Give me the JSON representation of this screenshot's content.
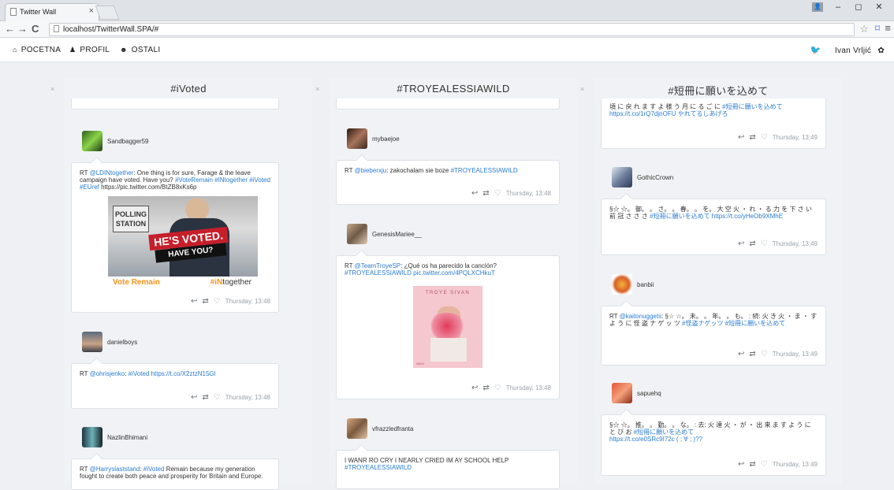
{
  "browser": {
    "tab_title": "Twitter Wall",
    "tab_close": "×",
    "url": "localhost/TwitterWall.SPA/#",
    "window_controls": [
      "–",
      "◻",
      "✕"
    ]
  },
  "nav": {
    "home": "POCETNA",
    "profile": "PROFIL",
    "other": "OSTALI",
    "user_name": "Ivan Vrljić"
  },
  "columns": [
    {
      "title": "#iVoted",
      "close": "×",
      "tweets": [
        {
          "user": "Sandbagger59",
          "pre": "RT ",
          "mention": "@LDINtogether",
          "body": ": One thing is for sure, Farage & the leave campaign have voted. Have you? ",
          "tags": "#VoteRemain #INtogether #iVoted #EUref",
          "link": " https://pic.twitter.com/BtZB8xKs6p",
          "time": "Thursday, 13:48",
          "image": {
            "sign1": "POLLING",
            "sign2": "STATION",
            "line1": "HE'S VOTED.",
            "line2": "HAVE YOU?",
            "foot_left": "Vote Remain",
            "foot_right_tag": "#iN",
            "foot_right": "together"
          }
        },
        {
          "user": "danielboys",
          "pre": "RT ",
          "mention": "@ohrisjenko",
          "body": ": ",
          "tags": "#iVoted",
          "link": " https://t.co/X2ztzN15Gl",
          "time": "Thursday, 13:48"
        },
        {
          "user": "NazlinBhimani",
          "pre": "RT ",
          "mention": "@Harryslaststand",
          "body": ": ",
          "tags": "#iVoted",
          "link": " Remain because my generation fought to create both peace and prosperity for Britain and Europe.",
          "time": ""
        }
      ]
    },
    {
      "title": "#TROYEALESSIAWILD",
      "close": "×",
      "tweets": [
        {
          "user": "mybaejoe",
          "pre": "RT ",
          "mention": "@bieberxju",
          "body": ": zakochalam sie boze ",
          "tags": "#TROYEALESSIAWILD",
          "link": "",
          "time": "Thursday, 13:48"
        },
        {
          "user": "GenesisMariee__",
          "pre": "RT ",
          "mention": "@TeamTroyeSP",
          "body": ": ¿Qué os ha parecido la canción? ",
          "tags": "#TROYEALESSIAWILD",
          "link": " pic.twitter.com/4PQLXCHkuT",
          "time": "Thursday, 13:48",
          "image": {
            "title": "TROYE SIVAN",
            "foot": "WILD"
          }
        },
        {
          "user": "vfrazzledfranta",
          "pre": "",
          "mention": "",
          "body": "I WANR RO CRY I NEARLY CRIED IM AY SCHOOL HELP ",
          "tags": "#TROYEALESSIAWILD",
          "link": "",
          "time": ""
        }
      ]
    },
    {
      "title": "#短冊に願いを込めて",
      "close": "×",
      "tweets": [
        {
          "user": "",
          "pre": "",
          "mention": "",
          "body": "頃 に 戻 れ ま す よ 様 う 月 に る ご に ",
          "tags": "#短冊に願いを込めて",
          "link": " https://t.co/1rQ7djnOFU やれてるしあげろ",
          "time": "Thursday, 13:49"
        },
        {
          "user": "GothicCrown",
          "pre": "",
          "mention": "",
          "body": "§☆ ☆。 御。 。 さ。 。 春。 。 を。 大 空 火 ・ れ ・ る 力 を 下 さ い 前 冠 さ さ さ ",
          "tags": "#短冊に願いを込めて",
          "link": " https://t.co/yHeOb9XMhE",
          "time": "Thursday, 13:49"
        },
        {
          "user": "banbii",
          "pre": "RT ",
          "mention": "@kaitonuggets",
          "body": ": §☆ ☆。 未。 。 年。 。 も。 : 続: 火 き 火 ・ ま ・ す よ う に 怪 盗 ナ ゲ ッ ツ ",
          "tags": "#怪盗ナゲッツ #短冊に願いを込めて",
          "link": "",
          "time": "Thursday, 13:49"
        },
        {
          "user": "sapuehq",
          "pre": "",
          "mention": "",
          "body": "§☆ ☆。 推。 。 勤。 。 な。 : 去: 火 達 火 ・ が ・ 出 来 ま す よ う に と び お ",
          "tags": "#短冊に願いを込めて",
          "link": " https://t.co/e0SRc9I72c ( ; ∀ ; )??",
          "time": "Thursday, 13:49"
        }
      ]
    }
  ],
  "colors": {
    "link": "#2b7bd0",
    "background": "#eef0f3",
    "card": "#ffffff"
  }
}
